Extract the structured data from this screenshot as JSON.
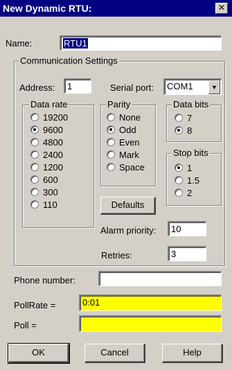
{
  "window": {
    "title": "New Dynamic RTU:",
    "close_label": "✕"
  },
  "name": {
    "label": "Name:",
    "value": "RTU1"
  },
  "comm": {
    "group_label": "Communication Settings",
    "address_label": "Address:",
    "address_value": "1",
    "serial_port_label": "Serial port:",
    "serial_port_value": "COM1",
    "data_rate": {
      "label": "Data rate",
      "options": [
        "19200",
        "9600",
        "4800",
        "2400",
        "1200",
        "600",
        "300",
        "110"
      ],
      "selected": "9600"
    },
    "parity": {
      "label": "Parity",
      "options": [
        "None",
        "Odd",
        "Even",
        "Mark",
        "Space"
      ],
      "selected": "Odd"
    },
    "data_bits": {
      "label": "Data bits",
      "options": [
        "7",
        "8"
      ],
      "selected": "8"
    },
    "stop_bits": {
      "label": "Stop bits",
      "options": [
        "1",
        "1.5",
        "2"
      ],
      "selected": "1"
    },
    "defaults_label": "Defaults",
    "alarm_priority_label": "Alarm priority:",
    "alarm_priority_value": "10",
    "retries_label": "Retries:",
    "retries_value": "3"
  },
  "phone": {
    "label": "Phone number:",
    "value": ""
  },
  "pollrate": {
    "label": "PollRate =",
    "value": "0:01"
  },
  "poll": {
    "label": "Poll =",
    "value": ""
  },
  "buttons": {
    "ok": "OK",
    "cancel": "Cancel",
    "help": "Help"
  },
  "colors": {
    "titlebar": "#000080",
    "face": "#d4d0c8",
    "highlight_field": "#ffff00"
  }
}
